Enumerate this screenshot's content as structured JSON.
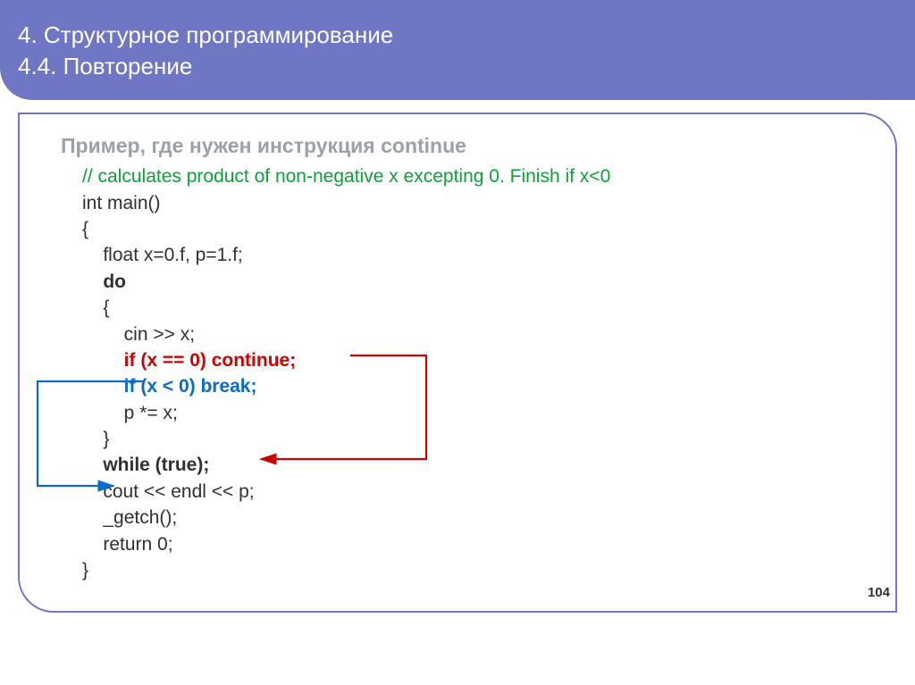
{
  "header": {
    "line1": "4. Структурное программирование",
    "line2": "4.4. Повторение"
  },
  "example_title": "Пример, где нужен инструкция continue",
  "code": {
    "comment": "// calculates product of non-negative x excepting 0. Finish if x<0",
    "l1": "int main()",
    "l2": "{",
    "l3": "    float x=0.f, p=1.f;",
    "l4_do": "    do",
    "l5": "    {",
    "l6": "        cin >> x;",
    "l7_red": "        if (x == 0) continue;",
    "l8_blue": "        if (x < 0) break;",
    "l9": "        p *= x;",
    "l10": "    }",
    "l11_while": "    while (true);",
    "l12": "    cout << endl << p;",
    "l13": "    _getch();",
    "l14": "    return 0;",
    "l15": "}"
  },
  "page_number": "104"
}
